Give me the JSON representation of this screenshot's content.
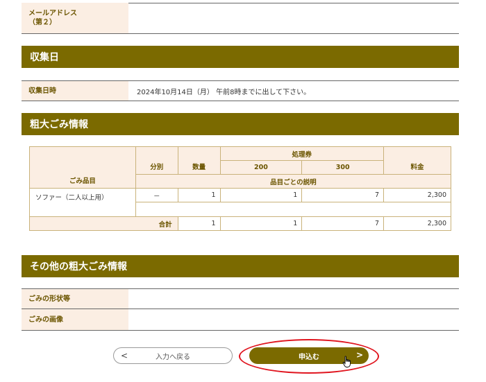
{
  "email2": {
    "label": "メールアドレス\n（第２）",
    "value": ""
  },
  "collection_section": {
    "title": "収集日"
  },
  "collection": {
    "label": "収集日時",
    "value": "2024年10月14日（月） 午前8時までに出して下さい。"
  },
  "bulky_section": {
    "title": "粗大ごみ情報"
  },
  "table": {
    "headers": {
      "item": "ごみ品目",
      "category": "分別",
      "quantity": "数量",
      "ticket": "処理券",
      "t200": "200",
      "t300": "300",
      "fee": "料金",
      "description": "品目ごとの説明"
    },
    "row": {
      "item": "ソファー（二人以上用）",
      "category": "－",
      "quantity": "1",
      "t200": "1",
      "t300": "7",
      "fee": "2,300"
    },
    "total": {
      "label": "合計",
      "quantity": "1",
      "t200": "1",
      "t300": "7",
      "fee": "2,300"
    }
  },
  "other_section": {
    "title": "その他の粗大ごみ情報"
  },
  "shape": {
    "label": "ごみの形状等",
    "value": ""
  },
  "image": {
    "label": "ごみの画像",
    "value": ""
  },
  "buttons": {
    "back_chevron": "<",
    "back": "入力へ戻る",
    "apply": "申込む",
    "apply_chevron": ">"
  },
  "colors": {
    "accent": "#7b6a00",
    "label_bg": "#fbeee3",
    "highlight": "#e0141e"
  }
}
